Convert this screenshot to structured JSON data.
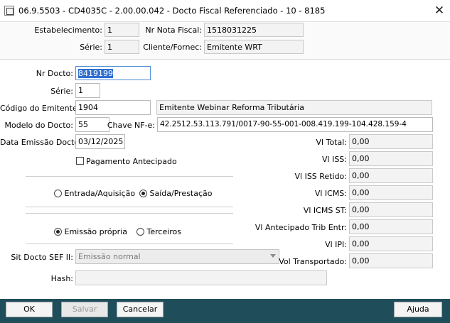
{
  "window": {
    "title": "06.9.5503 - CD4035C - 2.00.00.042 - Docto Fiscal Referenciado - 10 - 8185",
    "close_glyph": "✕",
    "icon": "app-window-icon"
  },
  "header": {
    "estabelecimento_label": "Estabelecimento:",
    "estabelecimento_value": "1",
    "nr_nota_fiscal_label": "Nr Nota Fiscal:",
    "nr_nota_fiscal_value": "1518031225",
    "serie_label": "Série:",
    "serie_value": "1",
    "cliente_fornec_label": "Cliente/Fornec:",
    "cliente_fornec_value": "Emitente WRT"
  },
  "form": {
    "nr_docto_label": "Nr Docto:",
    "nr_docto_value": "8419199",
    "serie_label": "Série:",
    "serie_value": "1",
    "codigo_emitente_label": "Código do Emitente:",
    "codigo_emitente_value": "1904",
    "emitente_nome_value": "Emitente Webinar Reforma Tributária",
    "modelo_docto_label": "Modelo do Docto:",
    "modelo_docto_value": "55",
    "chave_nfe_label": "Chave NF-e:",
    "chave_nfe_value": "42.2512.53.113.791/0017-90-55-001-008.419.199-104.428.159-4",
    "data_emissao_label": "Data Emissão Docto:",
    "data_emissao_value": "03/12/2025",
    "pagamento_antecipado_label": "Pagamento Antecipado",
    "pagamento_antecipado_checked": false,
    "direction_options": [
      {
        "label": "Entrada/Aquisição",
        "selected": false
      },
      {
        "label": "Saída/Prestação",
        "selected": true
      }
    ],
    "emission_options": [
      {
        "label": "Emissão própria",
        "selected": true
      },
      {
        "label": "Terceiros",
        "selected": false
      }
    ],
    "sit_docto_label": "Sit Docto SEF II:",
    "sit_docto_value": "Emissão normal",
    "hash_label": "Hash:",
    "hash_value": ""
  },
  "totals": [
    {
      "label": "Vl Total:",
      "value": "0,00"
    },
    {
      "label": "Vl ISS:",
      "value": "0,00"
    },
    {
      "label": "Vl ISS Retido:",
      "value": "0,00"
    },
    {
      "label": "Vl ICMS:",
      "value": "0,00"
    },
    {
      "label": "Vl ICMS ST:",
      "value": "0,00"
    },
    {
      "label": "Vl Antecipado Trib Entr:",
      "value": "0,00"
    },
    {
      "label": "Vl IPI:",
      "value": "0,00"
    },
    {
      "label": "Vol Transportado:",
      "value": "0,00"
    }
  ],
  "footer": {
    "ok_label": "OK",
    "salvar_label": "Salvar",
    "cancelar_label": "Cancelar",
    "ajuda_label": "Ajuda"
  },
  "colors": {
    "footer_bg": "#1f4e5a",
    "selection_bg": "#2f6fd0",
    "focus_border": "#4a8fd6"
  }
}
